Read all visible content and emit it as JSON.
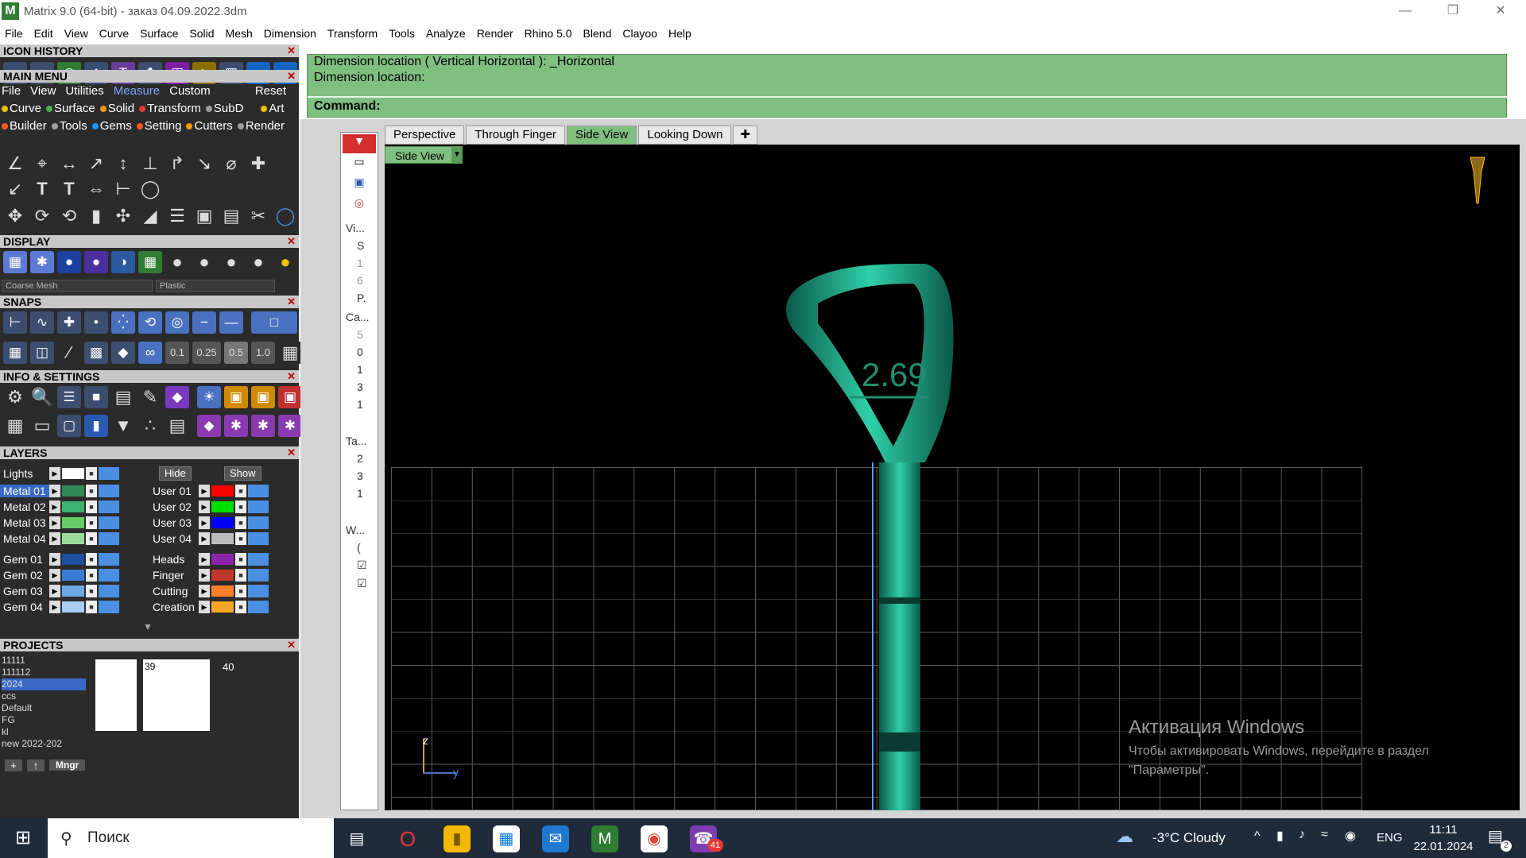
{
  "window": {
    "title": "Matrix 9.0 (64-bit) - заказ 04.09.2022.3dm",
    "app_icon": "matrix-logo-icon"
  },
  "menubar": [
    "File",
    "Edit",
    "View",
    "Curve",
    "Surface",
    "Solid",
    "Mesh",
    "Dimension",
    "Transform",
    "Tools",
    "Analyze",
    "Render",
    "Rhino 5.0",
    "Blend",
    "Clayoo",
    "Help"
  ],
  "panels": {
    "icon_history": "ICON HISTORY",
    "main_menu": "MAIN MENU",
    "display": "DISPLAY",
    "snaps": "SNAPS",
    "info_settings": "INFO & SETTINGS",
    "layers": "LAYERS",
    "projects": "PROJECTS"
  },
  "main_menu": {
    "tabs": [
      "File",
      "View",
      "Utilities",
      "Measure",
      "Custom"
    ],
    "reset": "Reset",
    "row1": [
      {
        "label": "Curve",
        "color": "#e6c200"
      },
      {
        "label": "Surface",
        "color": "#4caf50"
      },
      {
        "label": "Solid",
        "color": "#ff9800"
      },
      {
        "label": "Transform",
        "color": "#e53935"
      },
      {
        "label": "SubD",
        "color": "#9e9e9e"
      },
      {
        "label": "Art",
        "color": "#e6c200"
      }
    ],
    "row2": [
      {
        "label": "Builder",
        "color": "#ff5722"
      },
      {
        "label": "Tools",
        "color": "#9e9e9e"
      },
      {
        "label": "Gems",
        "color": "#2196f3"
      },
      {
        "label": "Setting",
        "color": "#ff5722"
      },
      {
        "label": "Cutters",
        "color": "#ff9800"
      },
      {
        "label": "Render",
        "color": "#9e9e9e"
      }
    ]
  },
  "display": {
    "mesh": "Coarse Mesh",
    "material": "Plastic"
  },
  "snaps": {
    "values": [
      "0.1",
      "0.25",
      "0.5",
      "1.0"
    ]
  },
  "layers": {
    "lights": "Lights",
    "hide": "Hide",
    "show": "Show",
    "left": [
      {
        "name": "Metal 01",
        "color": "#2e8b57",
        "selected": true
      },
      {
        "name": "Metal 02",
        "color": "#3cb371"
      },
      {
        "name": "Metal 03",
        "color": "#66cc66"
      },
      {
        "name": "Metal 04",
        "color": "#99dd99"
      },
      {
        "name": "Gem 01",
        "color": "#1e4fa0"
      },
      {
        "name": "Gem 02",
        "color": "#3a7bd5"
      },
      {
        "name": "Gem 03",
        "color": "#6fa8e8"
      },
      {
        "name": "Gem 04",
        "color": "#a9cdf5"
      }
    ],
    "right": [
      {
        "name": "User 01",
        "color": "#ff0000"
      },
      {
        "name": "User 02",
        "color": "#00dd00"
      },
      {
        "name": "User 03",
        "color": "#0000ff"
      },
      {
        "name": "User 04",
        "color": "#bbbbbb"
      },
      {
        "name": "Heads",
        "color": "#8e24aa"
      },
      {
        "name": "Finger",
        "color": "#c0392b"
      },
      {
        "name": "Cutting",
        "color": "#ff7f27"
      },
      {
        "name": "Creation",
        "color": "#f5a623"
      }
    ]
  },
  "projects": {
    "list": [
      "11111",
      "111112",
      "2024",
      "ccs",
      "Default",
      "FG",
      "kl",
      "new 2022-202"
    ],
    "selected": "2024",
    "thumb_number_1": "39",
    "thumb_number_2": "40",
    "mngr": "Mngr"
  },
  "command": {
    "line1": "Dimension location ( Vertical  Horizontal ): _Horizontal",
    "line2": "Dimension location:",
    "label": "Command:"
  },
  "viewport_tabs": [
    "Perspective",
    "Through Finger",
    "Side View",
    "Looking Down"
  ],
  "active_view": "Side View",
  "side_strip": [
    "Vi...",
    "S",
    "1",
    "6",
    "P.",
    "Ca...",
    "5",
    "0",
    "1",
    "3",
    "1",
    "Ta...",
    "2",
    "3",
    "1",
    "W...",
    "("
  ],
  "viewport": {
    "dimension_value": "2.69",
    "axis_z": "z",
    "axis_y": "y"
  },
  "activation": {
    "title": "Активация Windows",
    "text": "Чтобы активировать Windows, перейдите в раздел \"Параметры\"."
  },
  "taskbar": {
    "search": "Поиск",
    "weather": "-3°C  Cloudy",
    "lang": "ENG",
    "time": "11:11",
    "date": "22.01.2024",
    "badge_viber": "41",
    "notif_count": "2"
  }
}
